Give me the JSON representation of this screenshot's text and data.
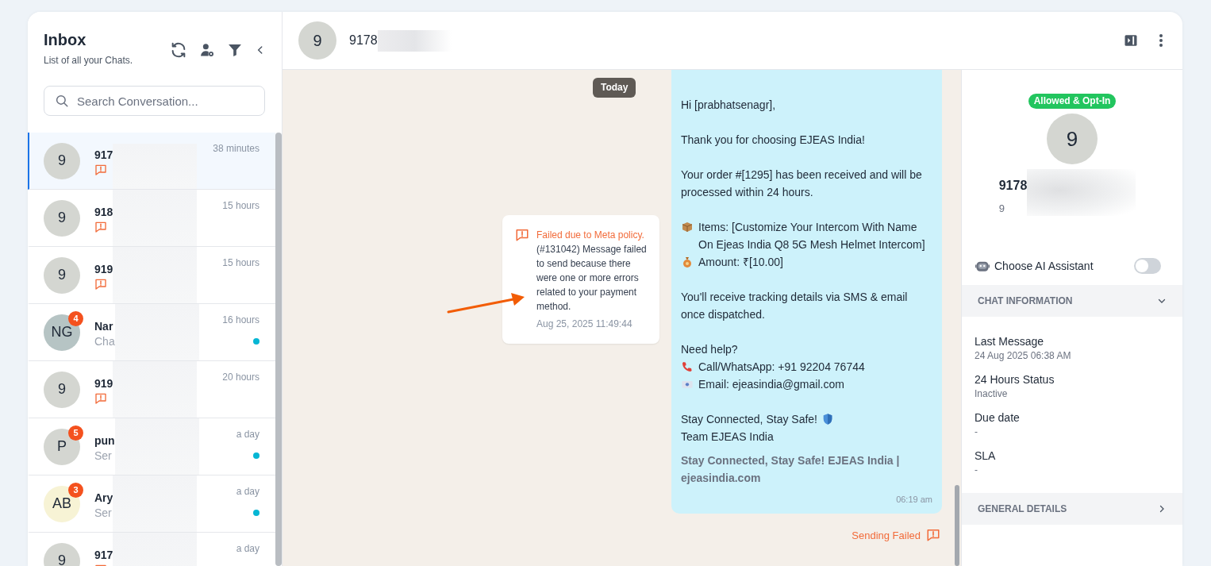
{
  "inbox": {
    "title": "Inbox",
    "subtitle": "List of all your Chats.",
    "search": {
      "placeholder": "Search Conversation..."
    },
    "chats": [
      {
        "avatar": "9",
        "color": "#d4d6d1",
        "name": "917",
        "kind": "failed",
        "time": "38 minutes",
        "selected": true
      },
      {
        "avatar": "9",
        "color": "#d4d6d1",
        "name": "918",
        "kind": "failed",
        "time": "15 hours",
        "selected": false
      },
      {
        "avatar": "9",
        "color": "#d4d6d1",
        "name": "919",
        "kind": "failed",
        "time": "15 hours",
        "selected": false
      },
      {
        "avatar": "NG",
        "color": "#b6c4c4",
        "badge": "4",
        "name": "Nar",
        "kind": "preview",
        "preview": "Cha",
        "unread": true,
        "time": "16 hours",
        "selected": false
      },
      {
        "avatar": "9",
        "color": "#d4d6d1",
        "name": "919",
        "kind": "failed",
        "time": "20 hours",
        "selected": false
      },
      {
        "avatar": "P",
        "color": "#d4d6d1",
        "badge": "5",
        "name": "pun",
        "kind": "preview",
        "preview": "Ser",
        "unread": true,
        "time": "a day",
        "selected": false
      },
      {
        "avatar": "AB",
        "color": "#f7f3d5",
        "badge": "3",
        "name": "Ary",
        "kind": "preview",
        "preview": "Ser",
        "unread": true,
        "time": "a day",
        "selected": false
      },
      {
        "avatar": "9",
        "color": "#d4d6d1",
        "name": "917",
        "kind": "failed",
        "time": "a day",
        "selected": false
      }
    ]
  },
  "conversation": {
    "header": {
      "avatar": "9",
      "name": "9178"
    },
    "date_chip": "Today",
    "failure_notice": {
      "title": "Failed due to Meta policy.",
      "body": "(#131042) Message failed to send because there were one or more errors related to your payment method.",
      "time": "Aug 25, 2025 11:49:44"
    },
    "message": {
      "paragraphs": [
        [
          {
            "kind": "plain",
            "text": "Hi [prabhatsenagr],"
          }
        ],
        [
          {
            "kind": "plain",
            "text": "Thank you for choosing EJEAS India!"
          }
        ],
        [
          {
            "kind": "plain",
            "text": "Your order #[1295] has been received and will be processed within 24 hours."
          }
        ],
        [
          {
            "kind": "package",
            "text": "Items: [Customize Your Intercom With Name On Ejeas India Q8 5G Mesh Helmet Intercom]"
          },
          {
            "kind": "money",
            "text": "Amount: ₹[10.00]"
          }
        ],
        [
          {
            "kind": "plain",
            "text": "You'll receive tracking details via SMS & email once dispatched."
          }
        ],
        [
          {
            "kind": "plain",
            "text": "Need help?"
          },
          {
            "kind": "phone",
            "text": "Call/WhatsApp: +91 92204 76744"
          },
          {
            "kind": "email",
            "text": "Email: ejeasindia@gmail.com"
          }
        ],
        [
          {
            "kind": "shield",
            "text": "Stay Connected, Stay Safe!"
          },
          {
            "kind": "plain",
            "text": "Team EJEAS India"
          }
        ]
      ],
      "footer": "Stay Connected, Stay Safe! EJEAS India | ejeasindia.com",
      "time": "06:19 am"
    },
    "delivery_status": "Sending Failed"
  },
  "contact": {
    "consent_badge": "Allowed & Opt-In",
    "avatar": "9",
    "name": "9178",
    "phone": "9",
    "ai_assistant": {
      "label": "Choose AI Assistant",
      "on": false
    },
    "sections": [
      {
        "title": "CHAT INFORMATION",
        "expanded": true,
        "fields": [
          {
            "label": "Last Message",
            "value": "24 Aug 2025 06:38 AM"
          },
          {
            "label": "24 Hours Status",
            "value": "Inactive"
          },
          {
            "label": "Due date",
            "value": "-"
          },
          {
            "label": "SLA",
            "value": "-"
          }
        ]
      },
      {
        "title": "GENERAL DETAILS",
        "expanded": false
      }
    ]
  }
}
